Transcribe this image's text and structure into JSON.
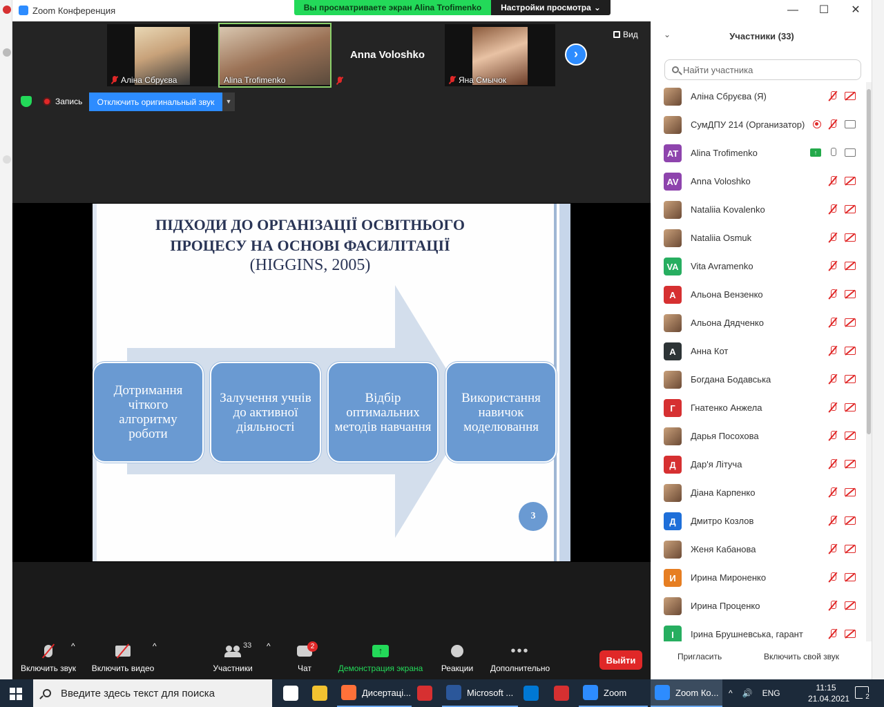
{
  "window": {
    "title": "Zoom Конференция",
    "share_banner": "Вы просматриваете экран Alina Trofimenko",
    "view_settings": "Настройки просмотра",
    "minimize": "—",
    "maximize": "☐",
    "close": "✕"
  },
  "video_strip": {
    "participants": [
      {
        "name": "Аліна Сбруєва",
        "muted": true,
        "video": true
      },
      {
        "name": "Alina Trofimenko",
        "muted": false,
        "video": true,
        "active": true
      },
      {
        "name": "Anna Voloshko",
        "muted": true,
        "video": false
      },
      {
        "name": "Яна Смычок",
        "muted": true,
        "video": true
      }
    ],
    "next": "›",
    "view_label": "Вид"
  },
  "meeting_bar": {
    "record_label": "Запись",
    "original_audio_label": "Отключить оригинальный звук",
    "dropdown": "▼"
  },
  "slide": {
    "title_line1": "ПІДХОДИ ДО ОРГАНІЗАЦІЇ ОСВІТНЬОГО",
    "title_line2": "ПРОЦЕСУ НА ОСНОВІ ФАСИЛІТАЦІЇ",
    "subtitle": "(HIGGINS, 2005)",
    "boxes": [
      "Дотримання чіткого алгоритму роботи",
      "Залучення учнів до активної діяльності",
      "Відбір оптимальних методів навчання",
      "Використання навичок моделювання"
    ],
    "page_number": "3",
    "colors": {
      "box": "#6a9ad2",
      "arrow": "#d3deec",
      "title": "#2a3556"
    }
  },
  "toolbar": {
    "unmute": "Включить звук",
    "start_video": "Включить видео",
    "participants": "Участники",
    "participants_count": "33",
    "chat": "Чат",
    "chat_badge": "2",
    "share_screen": "Демонстрация экрана",
    "reactions": "Реакции",
    "more": "Дополнительно",
    "leave": "Выйти",
    "caret": "^"
  },
  "panel": {
    "collapse": "⌄",
    "title": "Участники (33)",
    "search_placeholder": "Найти участника",
    "participants": [
      {
        "name": "Аліна Сбруєва (Я)",
        "avatar": "",
        "color": "photo",
        "mic": "off",
        "cam": "off"
      },
      {
        "name": "СумДПУ 214 (Организатор)",
        "avatar": "",
        "color": "photo",
        "mic": "off",
        "cam": "on",
        "recording": true
      },
      {
        "name": "Alina Trofimenko",
        "avatar": "AT",
        "color": "#8e44ad",
        "mic": "on",
        "cam": "on",
        "sharing": true
      },
      {
        "name": "Anna Voloshko",
        "avatar": "AV",
        "color": "#8e44ad",
        "mic": "off",
        "cam": "off"
      },
      {
        "name": "Nataliia Kovalenko",
        "avatar": "",
        "color": "photo",
        "mic": "off",
        "cam": "off"
      },
      {
        "name": "Nataliia Osmuk",
        "avatar": "",
        "color": "photo",
        "mic": "off",
        "cam": "off"
      },
      {
        "name": "Vita Avramenko",
        "avatar": "VA",
        "color": "#27ae60",
        "mic": "off",
        "cam": "off"
      },
      {
        "name": "Альона Вензенко",
        "avatar": "А",
        "color": "#d63031",
        "mic": "off",
        "cam": "off"
      },
      {
        "name": "Альона Дядченко",
        "avatar": "",
        "color": "photo",
        "mic": "off",
        "cam": "off"
      },
      {
        "name": "Анна Кот",
        "avatar": "А",
        "color": "#2d3436",
        "mic": "off",
        "cam": "off"
      },
      {
        "name": "Богдана Бодавська",
        "avatar": "",
        "color": "photo",
        "mic": "off",
        "cam": "off"
      },
      {
        "name": "Гнатенко Анжела",
        "avatar": "Г",
        "color": "#d63031",
        "mic": "off",
        "cam": "off"
      },
      {
        "name": "Дарья Посохова",
        "avatar": "",
        "color": "photo",
        "mic": "off",
        "cam": "off"
      },
      {
        "name": "Дар'я Літуча",
        "avatar": "Д",
        "color": "#d63031",
        "mic": "off",
        "cam": "off"
      },
      {
        "name": "Діана Карпенко",
        "avatar": "",
        "color": "photo",
        "mic": "off",
        "cam": "off"
      },
      {
        "name": "Дмитро Козлов",
        "avatar": "Д",
        "color": "#1e6fd9",
        "mic": "off",
        "cam": "off"
      },
      {
        "name": "Женя Кабанова",
        "avatar": "",
        "color": "photo",
        "mic": "off",
        "cam": "off"
      },
      {
        "name": "Ирина Мироненко",
        "avatar": "И",
        "color": "#e67e22",
        "mic": "off",
        "cam": "off"
      },
      {
        "name": "Ирина Проценко",
        "avatar": "",
        "color": "photo",
        "mic": "off",
        "cam": "off"
      },
      {
        "name": "Ірина Брушневська, гарант",
        "avatar": "І",
        "color": "#27ae60",
        "mic": "off",
        "cam": "off"
      }
    ],
    "invite": "Пригласить",
    "unmute_self": "Включить свой звук"
  },
  "taskbar": {
    "search_placeholder": "Введите здесь текст для поиска",
    "apps": [
      {
        "label": "",
        "color": "#ffffff",
        "kind": "task-view"
      },
      {
        "label": "",
        "color": "#f2c230",
        "kind": "explorer"
      },
      {
        "label": "Дисертаці...",
        "color": "#ff7139",
        "kind": "firefox"
      },
      {
        "label": "",
        "color": "#d63031",
        "kind": "app"
      },
      {
        "label": "Microsoft ...",
        "color": "#2b579a",
        "kind": "word"
      },
      {
        "label": "",
        "color": "#0078d4",
        "kind": "mail"
      },
      {
        "label": "",
        "color": "#d63031",
        "kind": "app2"
      },
      {
        "label": "Zoom",
        "color": "#2d8cff",
        "kind": "zoom"
      },
      {
        "label": "Zoom Ко...",
        "color": "#2d8cff",
        "kind": "zoom-meeting"
      }
    ],
    "tray_lang": "ENG",
    "tray_chevron": "^",
    "tray_volume": "🔊",
    "time": "11:15",
    "date": "21.04.2021",
    "notifications": "2"
  }
}
